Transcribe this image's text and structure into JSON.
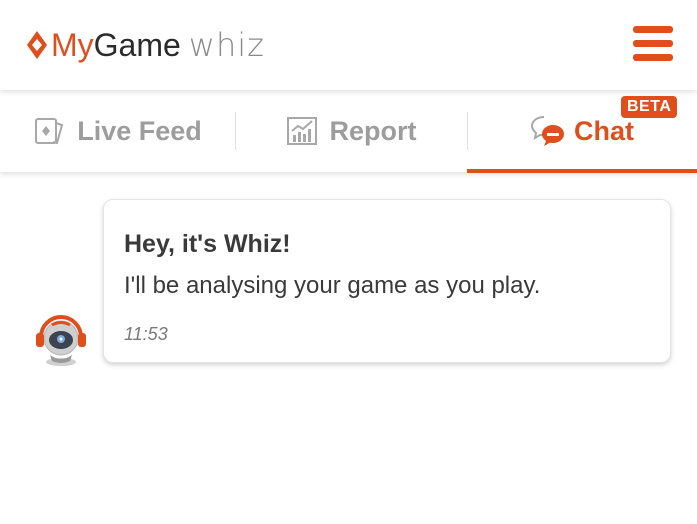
{
  "header": {
    "logo": {
      "my": "My",
      "game": "Game",
      "whiz": "whiz"
    },
    "menu_icon": "hamburger-menu-icon"
  },
  "tabs": [
    {
      "label": "Live Feed",
      "icon": "live-feed-icon",
      "active": false
    },
    {
      "label": "Report",
      "icon": "report-chart-icon",
      "active": false
    },
    {
      "label": "Chat",
      "icon": "chat-bubble-icon",
      "active": true,
      "badge": "BETA"
    }
  ],
  "chat": {
    "messages": [
      {
        "title": "Hey, it's Whiz!",
        "text": "I'll be analysing your game as you play.",
        "time": "11:53",
        "avatar": "whiz-robot-avatar"
      }
    ]
  },
  "colors": {
    "accent": "#e04e1c",
    "inactive_tab": "#9d9d9d",
    "text": "#3a3a3a"
  }
}
